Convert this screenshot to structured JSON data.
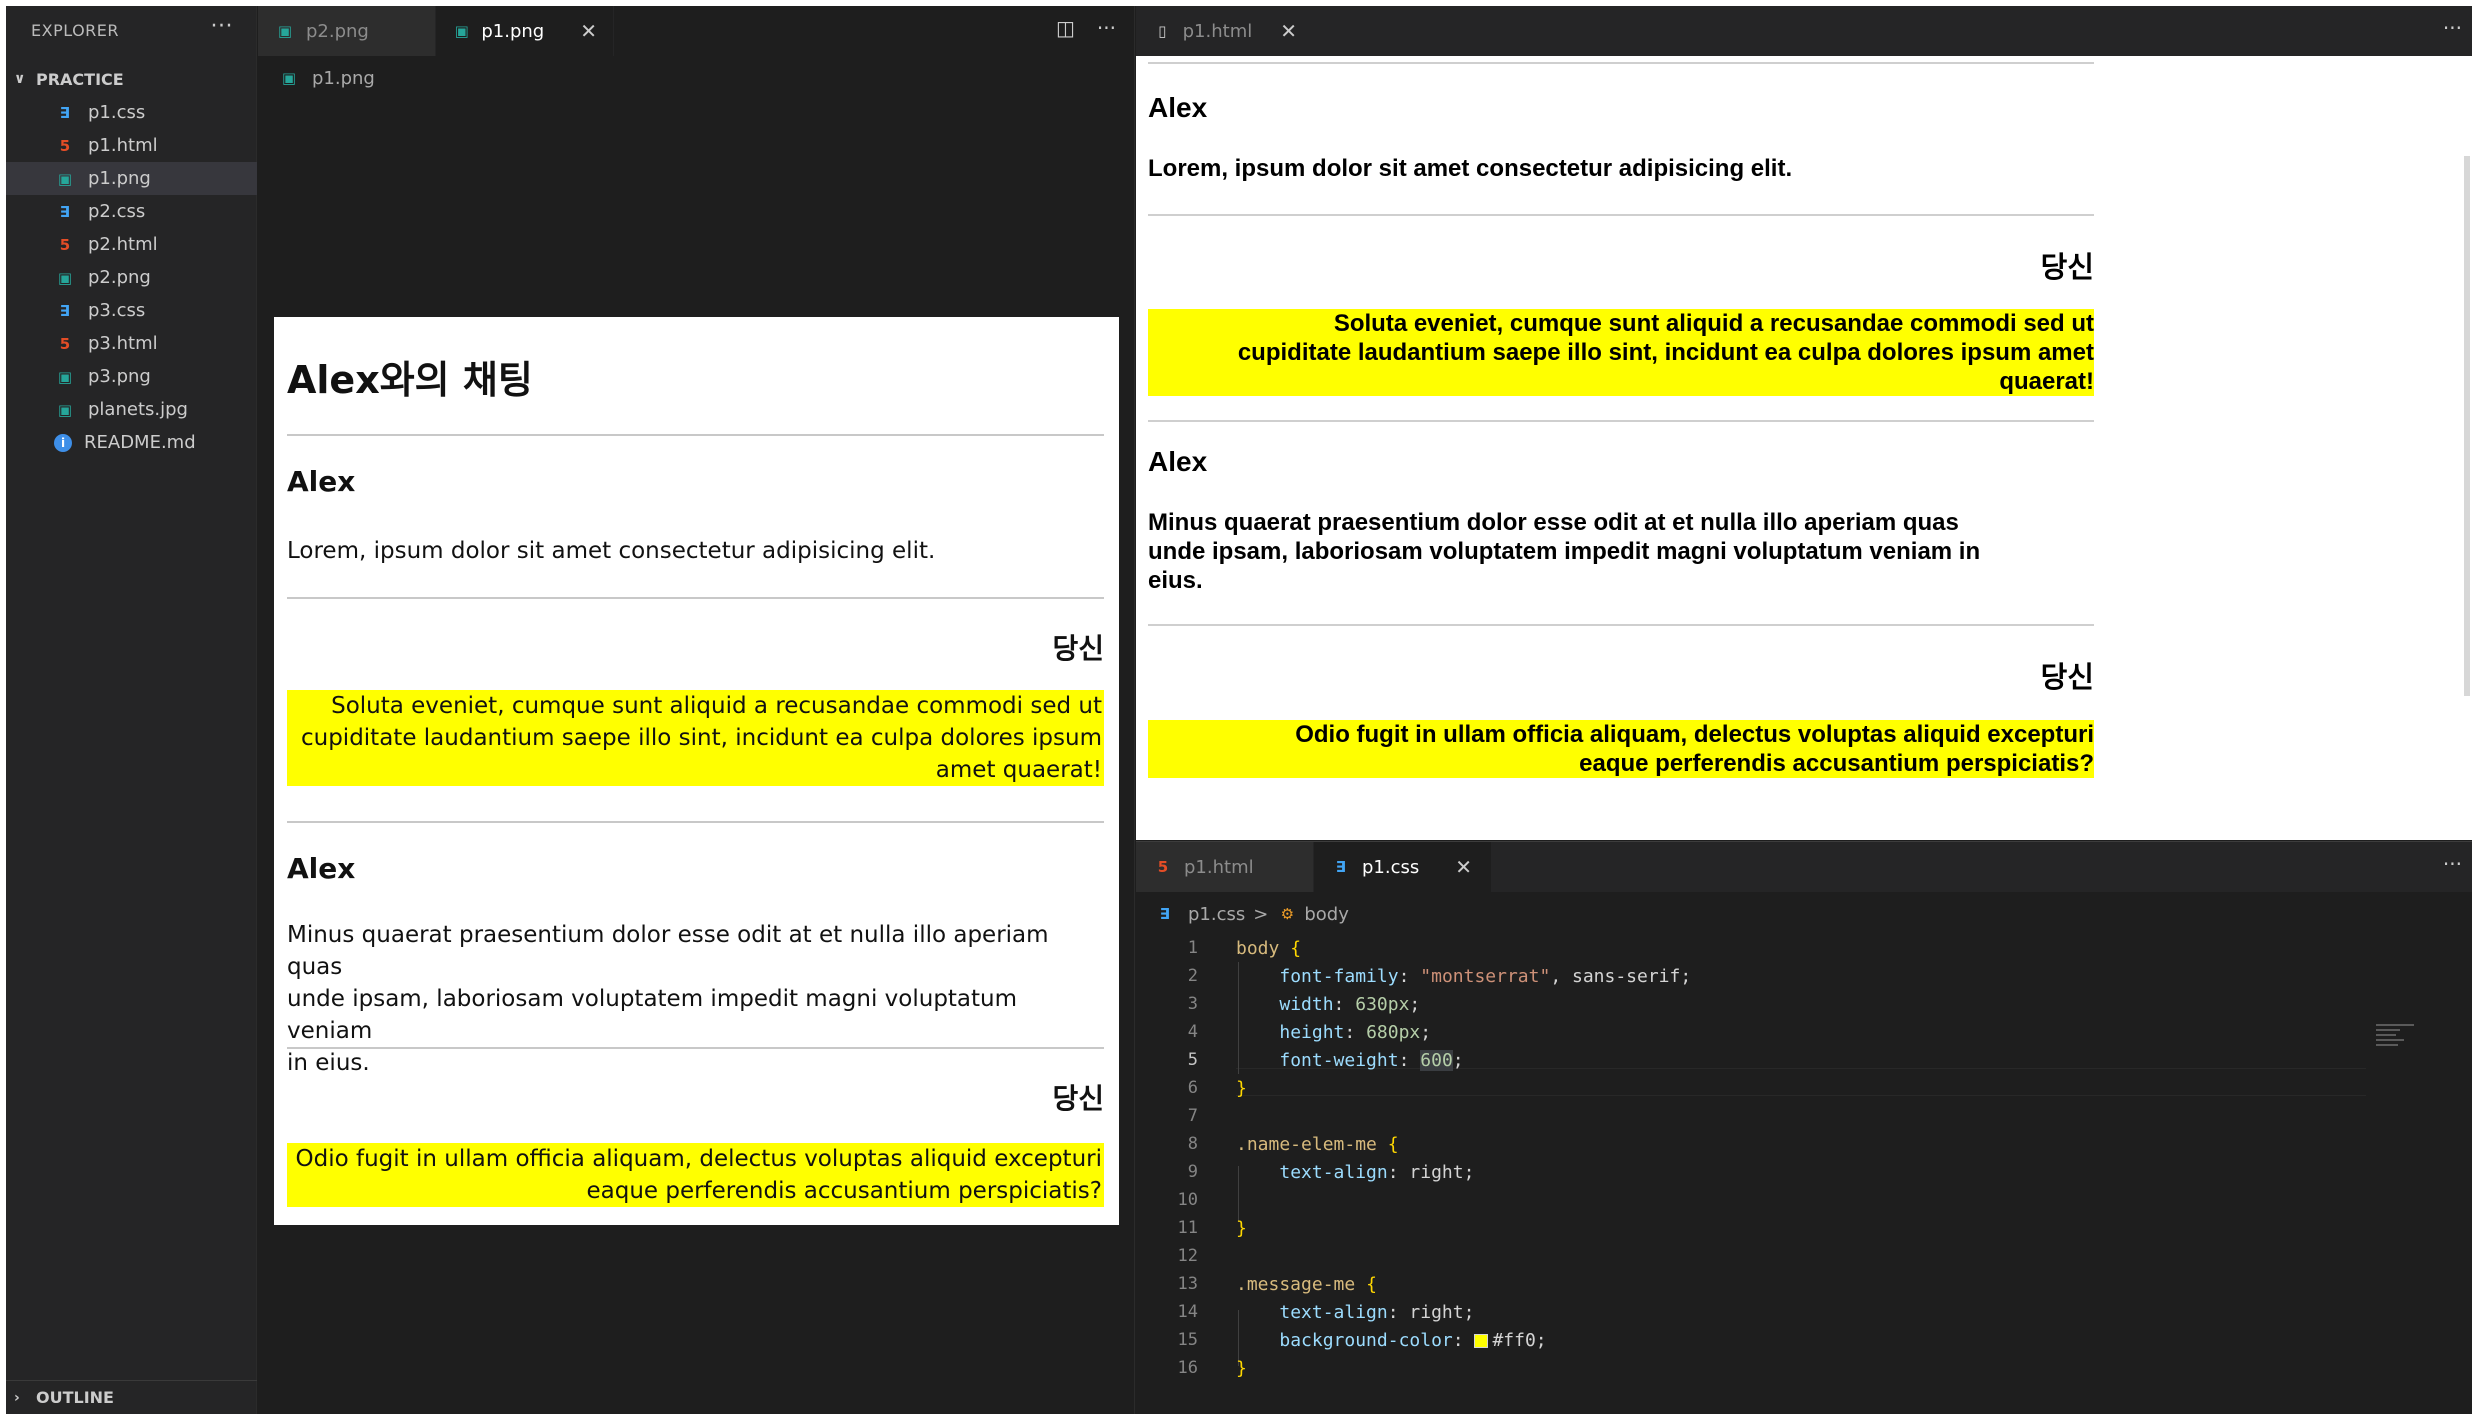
{
  "sidebar": {
    "title": "EXPLORER",
    "more": "···",
    "section": "PRACTICE",
    "files": [
      {
        "name": "p1.css",
        "icon": "css-file-icon"
      },
      {
        "name": "p1.html",
        "icon": "html-file-icon"
      },
      {
        "name": "p1.png",
        "icon": "image-file-icon"
      },
      {
        "name": "p2.css",
        "icon": "css-file-icon"
      },
      {
        "name": "p2.html",
        "icon": "html-file-icon"
      },
      {
        "name": "p2.png",
        "icon": "image-file-icon"
      },
      {
        "name": "p3.css",
        "icon": "css-file-icon"
      },
      {
        "name": "p3.html",
        "icon": "html-file-icon"
      },
      {
        "name": "p3.png",
        "icon": "image-file-icon"
      },
      {
        "name": "planets.jpg",
        "icon": "image-file-icon"
      },
      {
        "name": "README.md",
        "icon": "info-icon"
      }
    ],
    "selected_file": "p1.png",
    "outline": "OUTLINE"
  },
  "image_editor": {
    "tabs": [
      {
        "label": "p2.png",
        "active": false
      },
      {
        "label": "p1.png",
        "active": true
      }
    ],
    "breadcrumb": "p1.png",
    "preview": {
      "title": "Alex와의 채팅",
      "messages": [
        {
          "name": "Alex",
          "text": "Lorem, ipsum dolor sit amet consectetur adipisicing elit."
        },
        {
          "name": "당신",
          "text_lines": [
            "Soluta eveniet, cumque sunt aliquid a recusandae commodi sed ut",
            "cupiditate laudantium saepe illo sint, incidunt ea culpa dolores ipsum",
            "amet quaerat!"
          ]
        },
        {
          "name": "Alex",
          "text_lines": [
            "Minus quaerat praesentium dolor esse odit at et nulla illo aperiam quas",
            "unde ipsam, laboriosam voluptatem impedit magni voluptatum veniam",
            "in eius."
          ]
        },
        {
          "name": "당신",
          "text_lines": [
            "Odio fugit in ullam officia aliquam, delectus voluptas aliquid excepturi",
            "eaque perferendis accusantium perspiciatis?"
          ]
        }
      ]
    }
  },
  "web_preview": {
    "tab": "p1.html",
    "more": "···",
    "messages": [
      {
        "name": "Alex",
        "text": "Lorem, ipsum dolor sit amet consectetur adipisicing elit."
      },
      {
        "name": "당신",
        "text_lines": [
          "Soluta eveniet, cumque sunt aliquid a recusandae commodi sed ut",
          "cupiditate laudantium saepe illo sint, incidunt ea culpa dolores ipsum amet",
          "quaerat!"
        ]
      },
      {
        "name": "Alex",
        "text_lines": [
          "Minus quaerat praesentium dolor esse odit at et nulla illo aperiam quas",
          "unde ipsam, laboriosam voluptatem impedit magni voluptatum veniam in",
          "eius."
        ]
      },
      {
        "name": "당신",
        "text_lines": [
          "Odio fugit in ullam officia aliquam, delectus voluptas aliquid excepturi",
          "eaque perferendis accusantium perspiciatis?"
        ]
      }
    ]
  },
  "code_editor": {
    "tabs": [
      {
        "label": "p1.html",
        "active": false
      },
      {
        "label": "p1.css",
        "active": true
      }
    ],
    "more": "···",
    "breadcrumb": {
      "file": "p1.css",
      "separator": ">",
      "symbol": "body"
    },
    "current_line": 5,
    "lines": [
      "body {",
      "    font-family: \"montserrat\", sans-serif;",
      "    width: 630px;",
      "    height: 680px;",
      "    font-weight: 600;",
      "}",
      "",
      ".name-elem-me {",
      "    text-align: right;",
      "",
      "}",
      "",
      ".message-me {",
      "    text-align: right;",
      "    background-color: #ff0;",
      "}"
    ],
    "line_numbers": [
      "1",
      "2",
      "3",
      "4",
      "5",
      "6",
      "7",
      "8",
      "9",
      "10",
      "11",
      "12",
      "13",
      "14",
      "15",
      "16"
    ]
  },
  "colors": {
    "highlight": "#ffff00",
    "editor_bg": "#1e1e1e",
    "sidebar_bg": "#252526"
  }
}
